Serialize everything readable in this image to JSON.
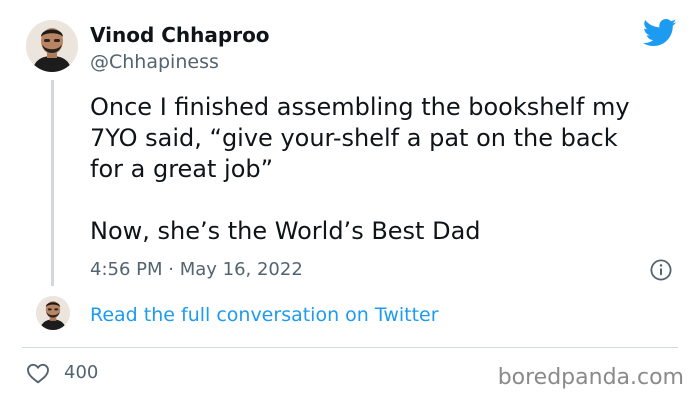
{
  "author": {
    "display_name": "Vinod Chhaproo",
    "handle": "@Chhapiness"
  },
  "tweet": {
    "lines": [
      "Once I finished assembling the bookshelf my",
      "7YO said, “give your-shelf a pat on the back",
      "for a great job”",
      "Now, she’s the World’s Best Dad"
    ],
    "timestamp": "4:56 PM · May 16, 2022"
  },
  "conversation": {
    "link_text": "Read the full conversation on Twitter"
  },
  "engagement": {
    "likes": "400"
  },
  "watermark": "boredpanda.com",
  "icons": {
    "brand": "twitter-bird-icon",
    "info": "info-icon",
    "like": "heart-icon"
  },
  "colors": {
    "twitter_blue": "#1d9bf0",
    "text_primary": "#0f1419",
    "text_secondary": "#536471",
    "divider": "#cfd9de"
  }
}
